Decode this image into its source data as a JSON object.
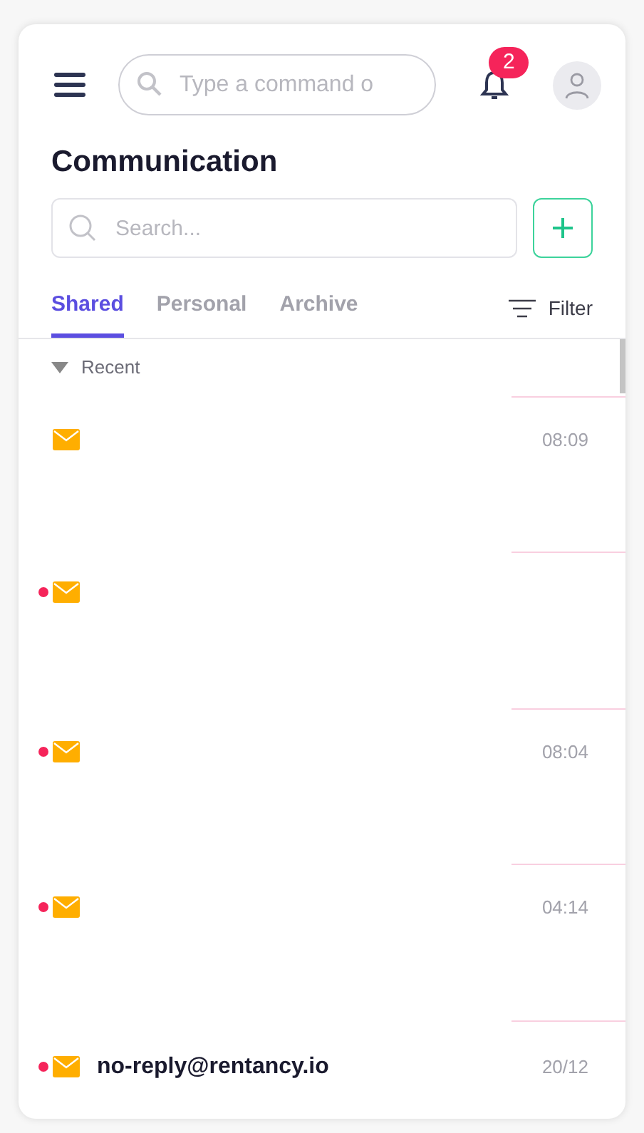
{
  "header": {
    "command_placeholder": "Type a command o",
    "notification_count": "2"
  },
  "title": "Communication",
  "search": {
    "placeholder": "Search..."
  },
  "tabs": [
    {
      "label": "Shared",
      "selected": true
    },
    {
      "label": "Personal",
      "selected": false
    },
    {
      "label": "Archive",
      "selected": false
    }
  ],
  "filter": "Filter",
  "group": {
    "label": "Recent",
    "expanded": true
  },
  "messages": [
    {
      "unread": false,
      "time": "08:09"
    },
    {
      "unread": true
    },
    {
      "unread": true,
      "time": "08:04"
    },
    {
      "unread": true,
      "time": "04:14"
    },
    {
      "unread": true,
      "sender": "no-reply@rentancy.io",
      "time": "20/12"
    }
  ]
}
